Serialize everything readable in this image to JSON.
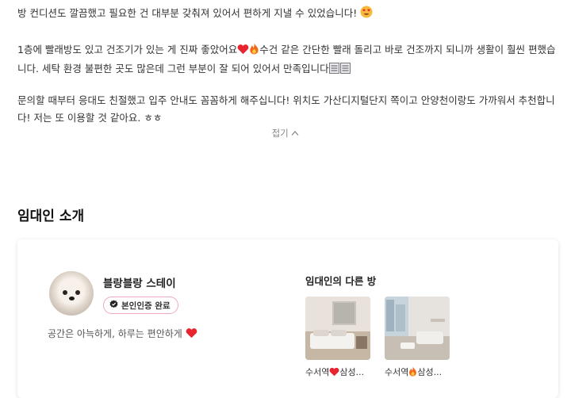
{
  "review": {
    "line1": "방 컨디션도 깔끔했고 필요한 건 대부분 갖춰져 있어서 편하게 지낼 수 있었습니다!",
    "para2": "1층에 빨래방도 있고 건조기가 있는 게 진짜 좋았어요",
    "para2_b": "수건 같은 간단한 빨래 돌리고 바로 건조까지 되니까 생활이 훨씬 편했습니다. 세탁 환경 불편한 곳도 많은데 그런 부분이 잘 되어 있어서 만족입니다",
    "para3": "문의할 때부터 응대도 친절했고 입주 안내도 꼼꼼하게 해주십니다! 위치도 가산디지털단지 쪽이고 안양천이랑도 가까워서 추천합니다! 저는 또 이용할 것 같아요. ㅎㅎ"
  },
  "collapse_label": "접기",
  "section_title": "임대인 소개",
  "host": {
    "name": "블랑블랑 스테이",
    "badge": "본인인증 완료",
    "intro": "공간은 아늑하게, 하루는 편안하게"
  },
  "other_rooms": {
    "title": "임대인의 다른 방",
    "rooms": [
      {
        "name_prefix": "수서역",
        "name_suffix": "삼성..."
      },
      {
        "name_prefix": "수서역",
        "name_suffix": "삼성..."
      }
    ]
  },
  "colors": {
    "accent_pink": "#f0a6c6",
    "heart_red": "#e8242f"
  }
}
